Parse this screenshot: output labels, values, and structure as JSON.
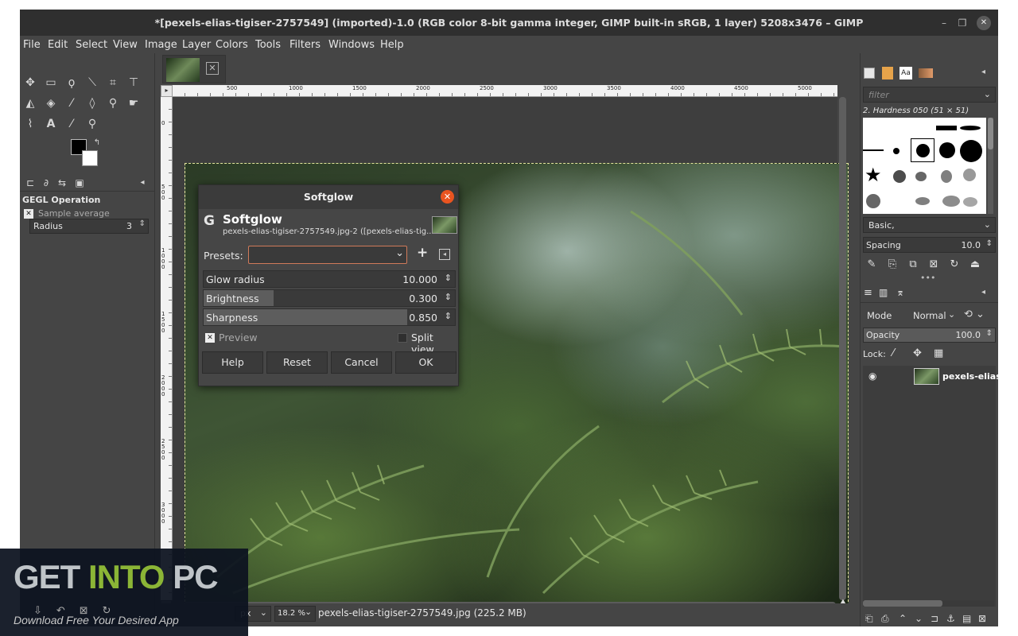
{
  "window": {
    "title": "*[pexels-elias-tigiser-2757549] (imported)-1.0 (RGB color 8-bit gamma integer, GIMP built-in sRGB, 1 layer) 5208x3476 – GIMP"
  },
  "menubar": {
    "items": [
      "File",
      "Edit",
      "Select",
      "View",
      "Image",
      "Layer",
      "Colors",
      "Tools",
      "Filters",
      "Windows",
      "Help"
    ]
  },
  "toolbox": {
    "icons": [
      "move-icon",
      "rect-select-icon",
      "free-select-icon",
      "fuzzy-select-icon",
      "crop-icon",
      "unified-transform-icon",
      "warp-icon",
      "bucket-fill-icon",
      "paintbrush-icon",
      "eraser-icon",
      "clone-icon",
      "smudge-icon",
      "paths-icon",
      "text-icon",
      "color-picker-icon",
      "zoom-icon"
    ],
    "tool_options_title": "GEGL Operation",
    "sample_average_label": "Sample average",
    "radius_label": "Radius",
    "radius_value": "3"
  },
  "canvas": {
    "hruler_labels": [
      "500",
      "1000",
      "1500",
      "2000",
      "2500",
      "3000",
      "3500",
      "4000",
      "4500",
      "5000"
    ],
    "vruler_labels": [
      "0",
      "500",
      "1000",
      "1500",
      "2000",
      "2500",
      "3000"
    ]
  },
  "statusbar": {
    "unit": "px",
    "zoom": "18.2 %",
    "text": "pexels-elias-tigiser-2757549.jpg (225.2 MB)"
  },
  "dialog": {
    "title": "Softglow",
    "heading": "Softglow",
    "subheading": "pexels-elias-tigiser-2757549.jpg-2 ([pexels-elias-tig...",
    "presets_label": "Presets:",
    "presets_value": "",
    "sliders": [
      {
        "label": "Glow radius",
        "value": "10.000",
        "fill": 0.0
      },
      {
        "label": "Brightness",
        "value": "0.300",
        "fill": 0.28
      },
      {
        "label": "Sharpness",
        "value": "0.850",
        "fill": 0.81
      }
    ],
    "preview_label": "Preview",
    "split_view_label": "Split view",
    "buttons": [
      "Help",
      "Reset",
      "Cancel",
      "OK"
    ]
  },
  "dock": {
    "filter_placeholder": "filter",
    "brush_name": "2. Hardness 050 (51 × 51)",
    "tag": "Basic,",
    "spacing_label": "Spacing",
    "spacing_value": "10.0",
    "mode_label": "Mode",
    "mode_value": "Normal",
    "opacity_label": "Opacity",
    "opacity_value": "100.0",
    "lock_label": "Lock:",
    "layer_name": "pexels-elias-"
  },
  "watermark": {
    "get": "GET",
    "into": "INTO",
    "pc": "PC",
    "tagline": "Download Free Your Desired App"
  }
}
